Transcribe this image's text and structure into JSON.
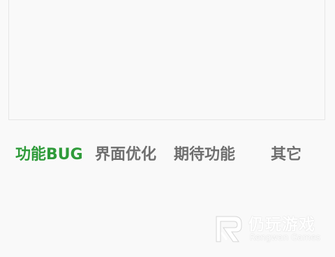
{
  "feedback": {
    "text_value": ""
  },
  "tabs": [
    {
      "label": "功能BUG",
      "active": true
    },
    {
      "label": "界面优化",
      "active": false
    },
    {
      "label": "期待功能",
      "active": false
    },
    {
      "label": "其它",
      "active": false
    }
  ],
  "colors": {
    "active_tab": "#2f9b3a",
    "inactive_tab": "#6f6f6f",
    "background": "#f9f9f9"
  },
  "watermark": {
    "title": "仍玩游戏",
    "subtitle": "Rengwan Games",
    "logo_icon": "rengwan-logo-icon"
  }
}
